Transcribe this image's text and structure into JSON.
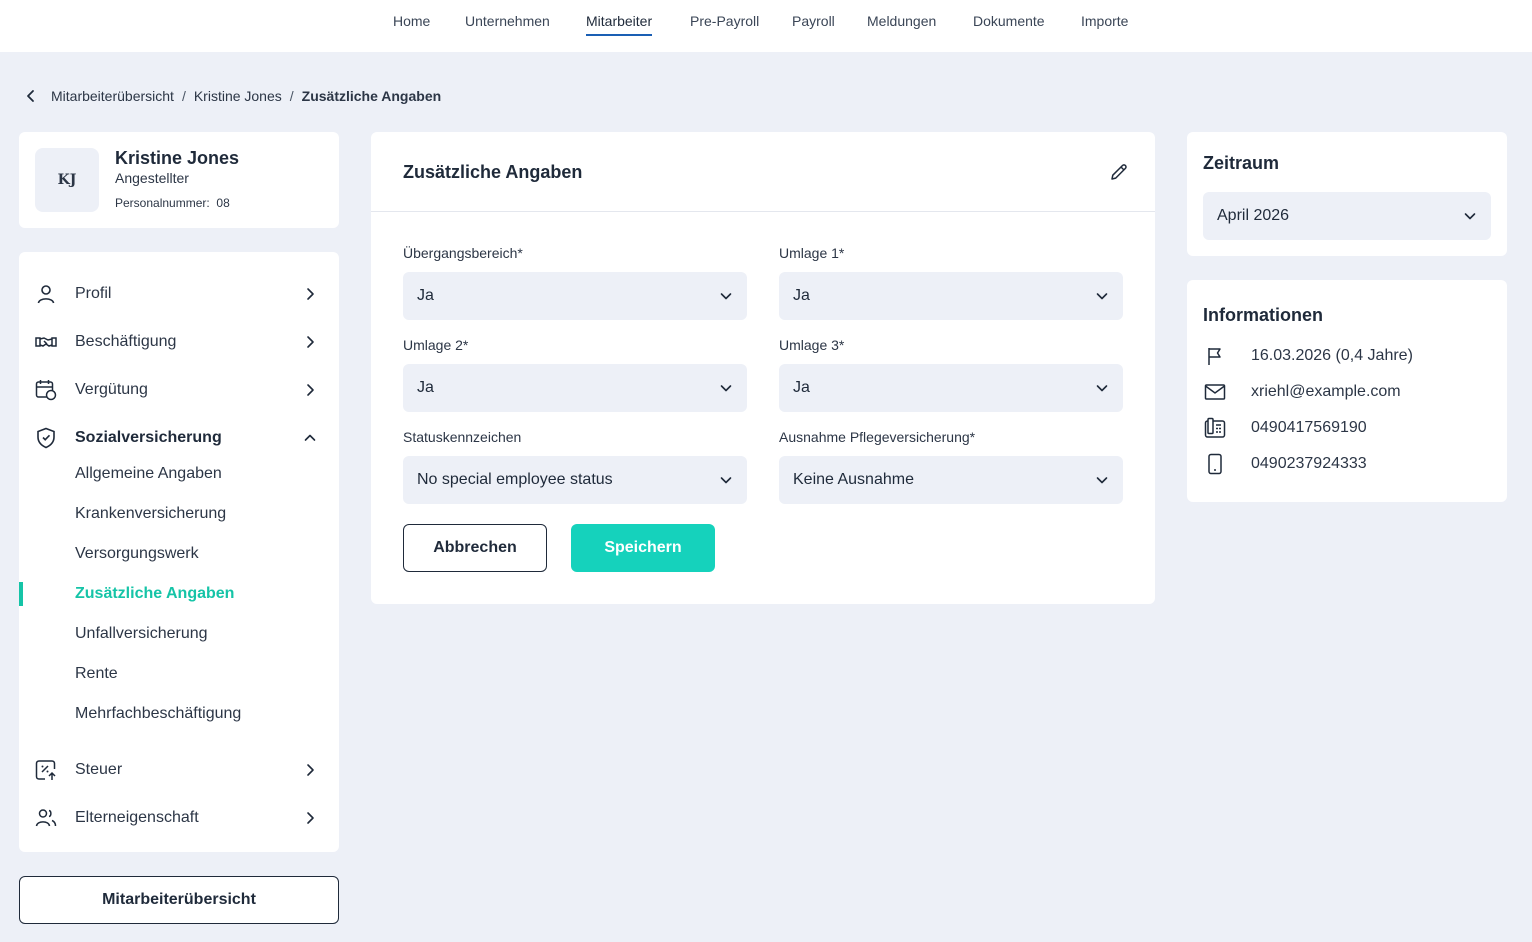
{
  "nav": {
    "items": [
      "Home",
      "Unternehmen",
      "Mitarbeiter",
      "Pre-Payroll",
      "Payroll",
      "Meldungen",
      "Dokumente",
      "Importe"
    ],
    "active": "Mitarbeiter"
  },
  "breadcrumb": {
    "items": [
      "Mitarbeiterübersicht",
      "Kristine Jones"
    ],
    "current": "Zusätzliche Angaben",
    "separator": "/"
  },
  "profile": {
    "initials": "KJ",
    "name": "Kristine Jones",
    "role": "Angestellter",
    "number_label": "Personalnummer:",
    "number": "08"
  },
  "sidebar": {
    "items": [
      {
        "label": "Profil",
        "icon": "user-icon"
      },
      {
        "label": "Beschäftigung",
        "icon": "handshake-icon"
      },
      {
        "label": "Vergütung",
        "icon": "calendar-money-icon"
      },
      {
        "label": "Sozialversicherung",
        "icon": "shield-icon",
        "expanded": true
      },
      {
        "label": "Steuer",
        "icon": "tax-icon"
      },
      {
        "label": "Elterneigenschaft",
        "icon": "people-icon"
      }
    ],
    "subitems": [
      "Allgemeine Angaben",
      "Krankenversicherung",
      "Versorgungswerk",
      "Zusätzliche Angaben",
      "Unfallversicherung",
      "Rente",
      "Mehrfachbeschäftigung"
    ],
    "active_subitem": "Zusätzliche Angaben",
    "overview_button": "Mitarbeiterübersicht"
  },
  "form": {
    "title": "Zusätzliche Angaben",
    "fields": [
      {
        "label": "Übergangsbereich*",
        "value": "Ja"
      },
      {
        "label": "Umlage 1*",
        "value": "Ja"
      },
      {
        "label": "Umlage 2*",
        "value": "Ja"
      },
      {
        "label": "Umlage 3*",
        "value": "Ja"
      },
      {
        "label": "Statuskennzeichen",
        "value": "No special employee status"
      },
      {
        "label": "Ausnahme Pflegeversicherung*",
        "value": "Keine Ausnahme"
      }
    ],
    "cancel_label": "Abbrechen",
    "save_label": "Speichern"
  },
  "zeitraum": {
    "title": "Zeitraum",
    "value": "April 2026"
  },
  "info": {
    "title": "Informationen",
    "rows": [
      {
        "icon": "flag-icon",
        "text": "16.03.2026 (0,4 Jahre)"
      },
      {
        "icon": "mail-icon",
        "text": "xriehl@example.com"
      },
      {
        "icon": "phone-icon",
        "text": "0490417569190"
      },
      {
        "icon": "mobile-icon",
        "text": "0490237924333"
      }
    ]
  },
  "colors": {
    "accent": "#15d2bc",
    "active_nav_underline": "#1a5fb4",
    "background": "#edf0f7"
  }
}
